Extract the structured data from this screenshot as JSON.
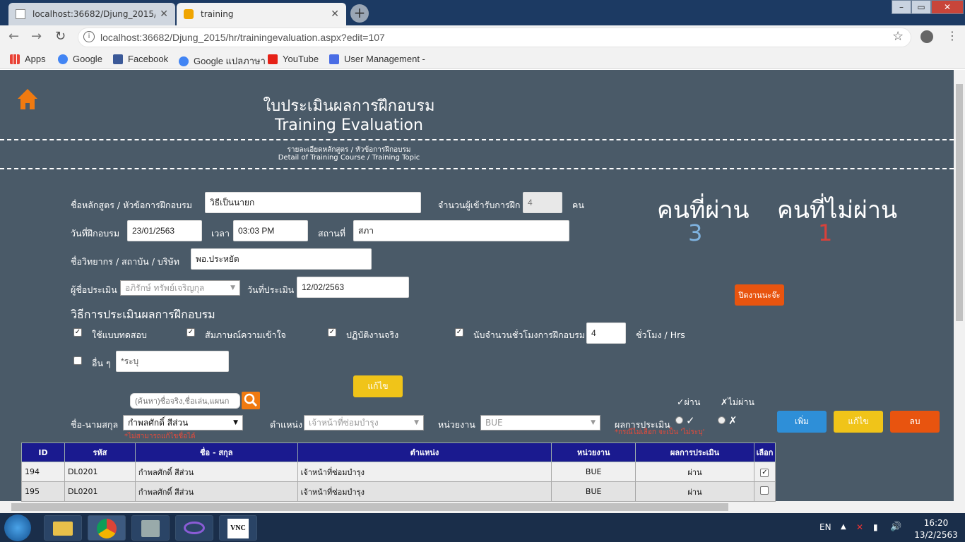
{
  "browser": {
    "tabs": [
      {
        "title": "localhost:36682/Djung_2015/hr/t",
        "active": false
      },
      {
        "title": "training",
        "active": true
      }
    ],
    "url": "localhost:36682/Djung_2015/hr/trainingevaluation.aspx?edit=107",
    "bookmarks": [
      "Apps",
      "Google",
      "Facebook",
      "Google แปลภาษา",
      "YouTube",
      "User Management -"
    ]
  },
  "header": {
    "title_th": "ใบประเมินผลการฝึกอบรม",
    "title_en": "Training Evaluation",
    "subtitle_th": "รายละเอียดหลักสูตร / หัวข้อการฝึกอบรม",
    "subtitle_en": "Detail of Training Course / Training Topic"
  },
  "form": {
    "course_label": "ชื่อหลักสูตร / หัวข้อการฝึกอบรม",
    "course_value": "วิธีเป็นนายก",
    "attendees_label": "จำนวนผู้เข้ารับการฝึก",
    "attendees_value": "4",
    "attendees_unit": "คน",
    "date_label": "วันที่ฝึกอบรม",
    "date_value": "23/01/2563",
    "time_label": "เวลา",
    "time_value": "03:03 PM",
    "place_label": "สถานที่",
    "place_value": "สภา",
    "lecturer_label": "ชื่อวิทยากร / สถาบัน / บริษัท",
    "lecturer_value": "พอ.ประหยัด",
    "evaluator_label": "ผู้ชื่อประเมิน",
    "evaluator_value": "อภิรักษ์ ทรัพย์เจริญกุล",
    "eval_date_label": "วันที่ประเมิน",
    "eval_date_value": "12/02/2563",
    "method_heading": "วิธีการประเมินผลการฝึกอบรม",
    "methods": [
      {
        "label": "ใช้แบบทดสอบ",
        "checked": true
      },
      {
        "label": "สัมภาษณ์ความเข้าใจ",
        "checked": true
      },
      {
        "label": "ปฏิบัติงานจริง",
        "checked": true
      },
      {
        "label": "นับจำนวนชั่วโมงการฝึกอบรม",
        "checked": true
      }
    ],
    "hours_value": "4",
    "hours_unit": "ชั่วโมง / Hrs",
    "other_label": "อื่น ๆ",
    "other_checked": false,
    "other_placeholder": "*ระบุ",
    "edit_button": "แก้ไข",
    "close_button": "ปิดงานนะจ๊ะ"
  },
  "stats": {
    "pass_label": "คนที่ผ่าน",
    "pass_count": "3",
    "fail_label": "คนที่ไม่ผ่าน",
    "fail_count": "1",
    "pass_color": "#7fb3e0",
    "fail_color": "#d9413a"
  },
  "entry": {
    "search_placeholder": "(ค้นหา)ชื่อจริง,ชื่อเล่น,แผนก",
    "name_label": "ชื่อ-นามสกุล",
    "name_value": "กำพลศักดิ์ สีส่วน",
    "name_note": "*ไม่สามารถแก้ไขชื่อได้",
    "position_label": "ตำแหน่ง",
    "position_value": "เจ้าหน้าที่ซ่อมบำรุง",
    "unit_label": "หน่วยงาน",
    "unit_value": "BUE",
    "result_label": "ผลการประเมิน",
    "pass_header": "✓ผ่าน",
    "fail_header": "✗ไม่ผ่าน",
    "pass_mark": "✓",
    "fail_mark": "✗",
    "result_note": "*กรณีไม่เลือก จะเป็น 'ไม่ระบุ'",
    "add_button": "เพิ่ม",
    "edit_button": "แก้ไข",
    "delete_button": "ลบ",
    "colors": {
      "add": "#2e8fd8",
      "edit": "#f0c419",
      "delete": "#e8540f",
      "close": "#e8540f"
    }
  },
  "table": {
    "headers": [
      "ID",
      "รหัส",
      "ชื่อ - สกุล",
      "ตำแหน่ง",
      "หน่วยงาน",
      "ผลการประเมิน",
      "เลือก"
    ],
    "rows": [
      {
        "id": "194",
        "code": "DL0201",
        "name": "กำพลศักดิ์ สีส่วน",
        "position": "เจ้าหน้าที่ซ่อมบำรุง",
        "unit": "BUE",
        "result": "ผ่าน",
        "selected": true
      },
      {
        "id": "195",
        "code": "DL0201",
        "name": "กำพลศักดิ์ สีส่วน",
        "position": "เจ้าหน้าที่ซ่อมบำรุง",
        "unit": "BUE",
        "result": "ผ่าน",
        "selected": false
      }
    ]
  },
  "taskbar": {
    "lang": "EN",
    "time": "16:20",
    "date": "13/2/2563"
  }
}
